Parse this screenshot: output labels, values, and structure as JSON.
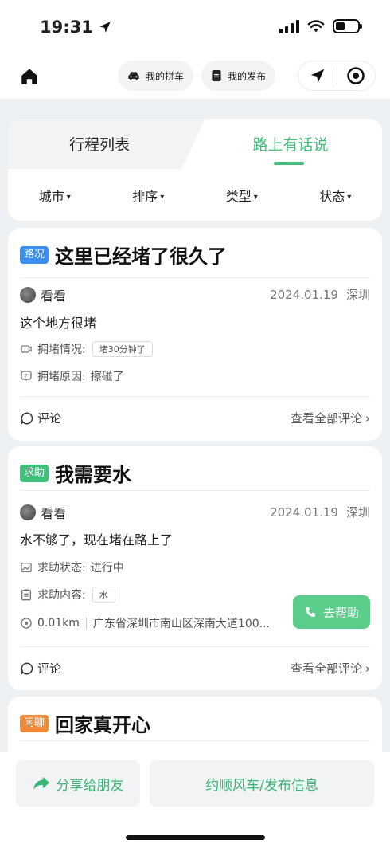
{
  "status_bar": {
    "time": "19:31"
  },
  "nav": {
    "carpool_label": "我的拼车",
    "publish_label": "我的发布"
  },
  "tabs": {
    "left": "行程列表",
    "right": "路上有话说",
    "active": "right"
  },
  "filters": [
    "城市",
    "排序",
    "类型",
    "状态"
  ],
  "posts": [
    {
      "tag": "路况",
      "tag_color": "#3a8ff0",
      "title": "这里已经堵了很久了",
      "author": "看看",
      "date": "2024.01.19",
      "city": "深圳",
      "content": "这个地方很堵",
      "info1_label": "拥堵情况:",
      "info1_chip": "堵30分钟了",
      "info2_label": "拥堵原因:",
      "info2_value": "擦碰了",
      "comment_label": "评论",
      "view_all_label": "查看全部评论"
    },
    {
      "tag": "求助",
      "tag_color": "#3ec07a",
      "title": "我需要水",
      "author": "看看",
      "date": "2024.01.19",
      "city": "深圳",
      "content": "水不够了，现在堵在路上了",
      "info1_label": "求助状态:",
      "info1_value": "进行中",
      "info2_label": "求助内容:",
      "info2_chip": "水",
      "distance": "0.01km",
      "address": "广东省深圳市南山区深南大道100...",
      "help_label": "去帮助",
      "comment_label": "评论",
      "view_all_label": "查看全部评论"
    },
    {
      "tag": "闲聊",
      "tag_color": "#f08a3a",
      "title": "回家真开心"
    }
  ],
  "bottom": {
    "share_label": "分享给朋友",
    "primary_label": "约顺风车/发布信息"
  },
  "colors": {
    "accent": "#3ec07a",
    "blue_tag": "#3a8ff0",
    "orange_tag": "#f08a3a"
  }
}
